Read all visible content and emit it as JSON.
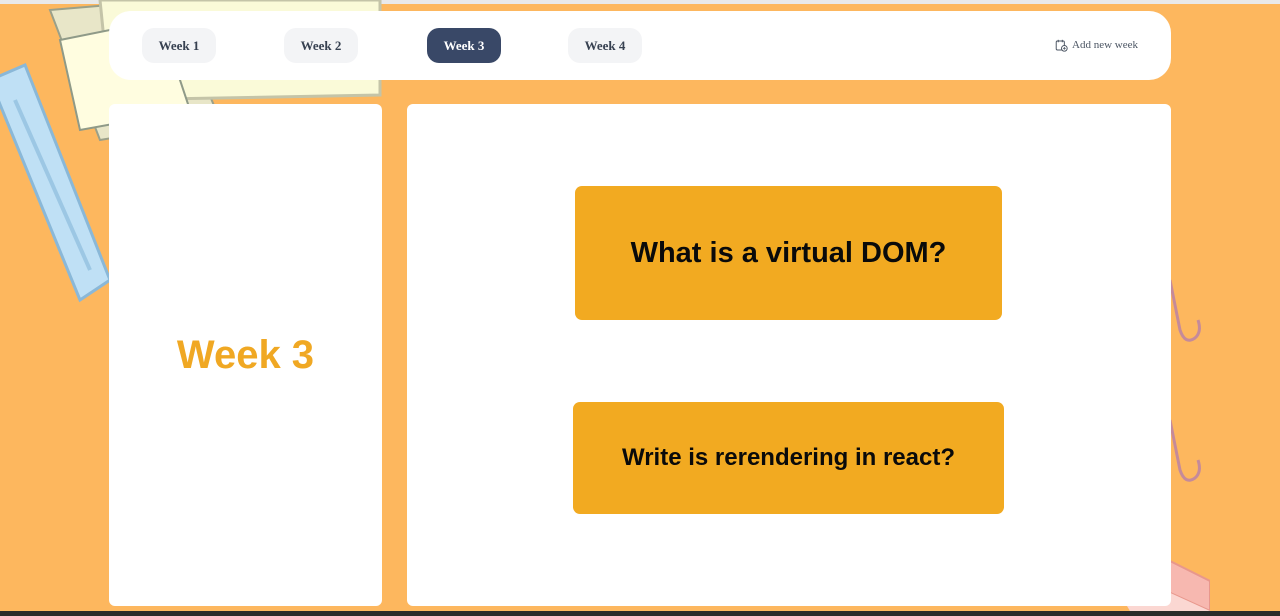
{
  "navbar": {
    "weeks": [
      {
        "label": "Week 1"
      },
      {
        "label": "Week 2"
      },
      {
        "label": "Week 3"
      },
      {
        "label": "Week 4"
      }
    ],
    "active_week_index": 2,
    "add_week_label": "Add new week",
    "add_week_icon": "calendar-plus-icon"
  },
  "sidebar": {
    "title": "Week 3"
  },
  "cards": [
    {
      "question": "What is a virtual DOM?"
    },
    {
      "question": "Write is rerendering in react?"
    }
  ],
  "colors": {
    "background": "#fdb75e",
    "accent": "#f2aa21",
    "active_tab": "#394867",
    "title_text": "#f0a823"
  }
}
